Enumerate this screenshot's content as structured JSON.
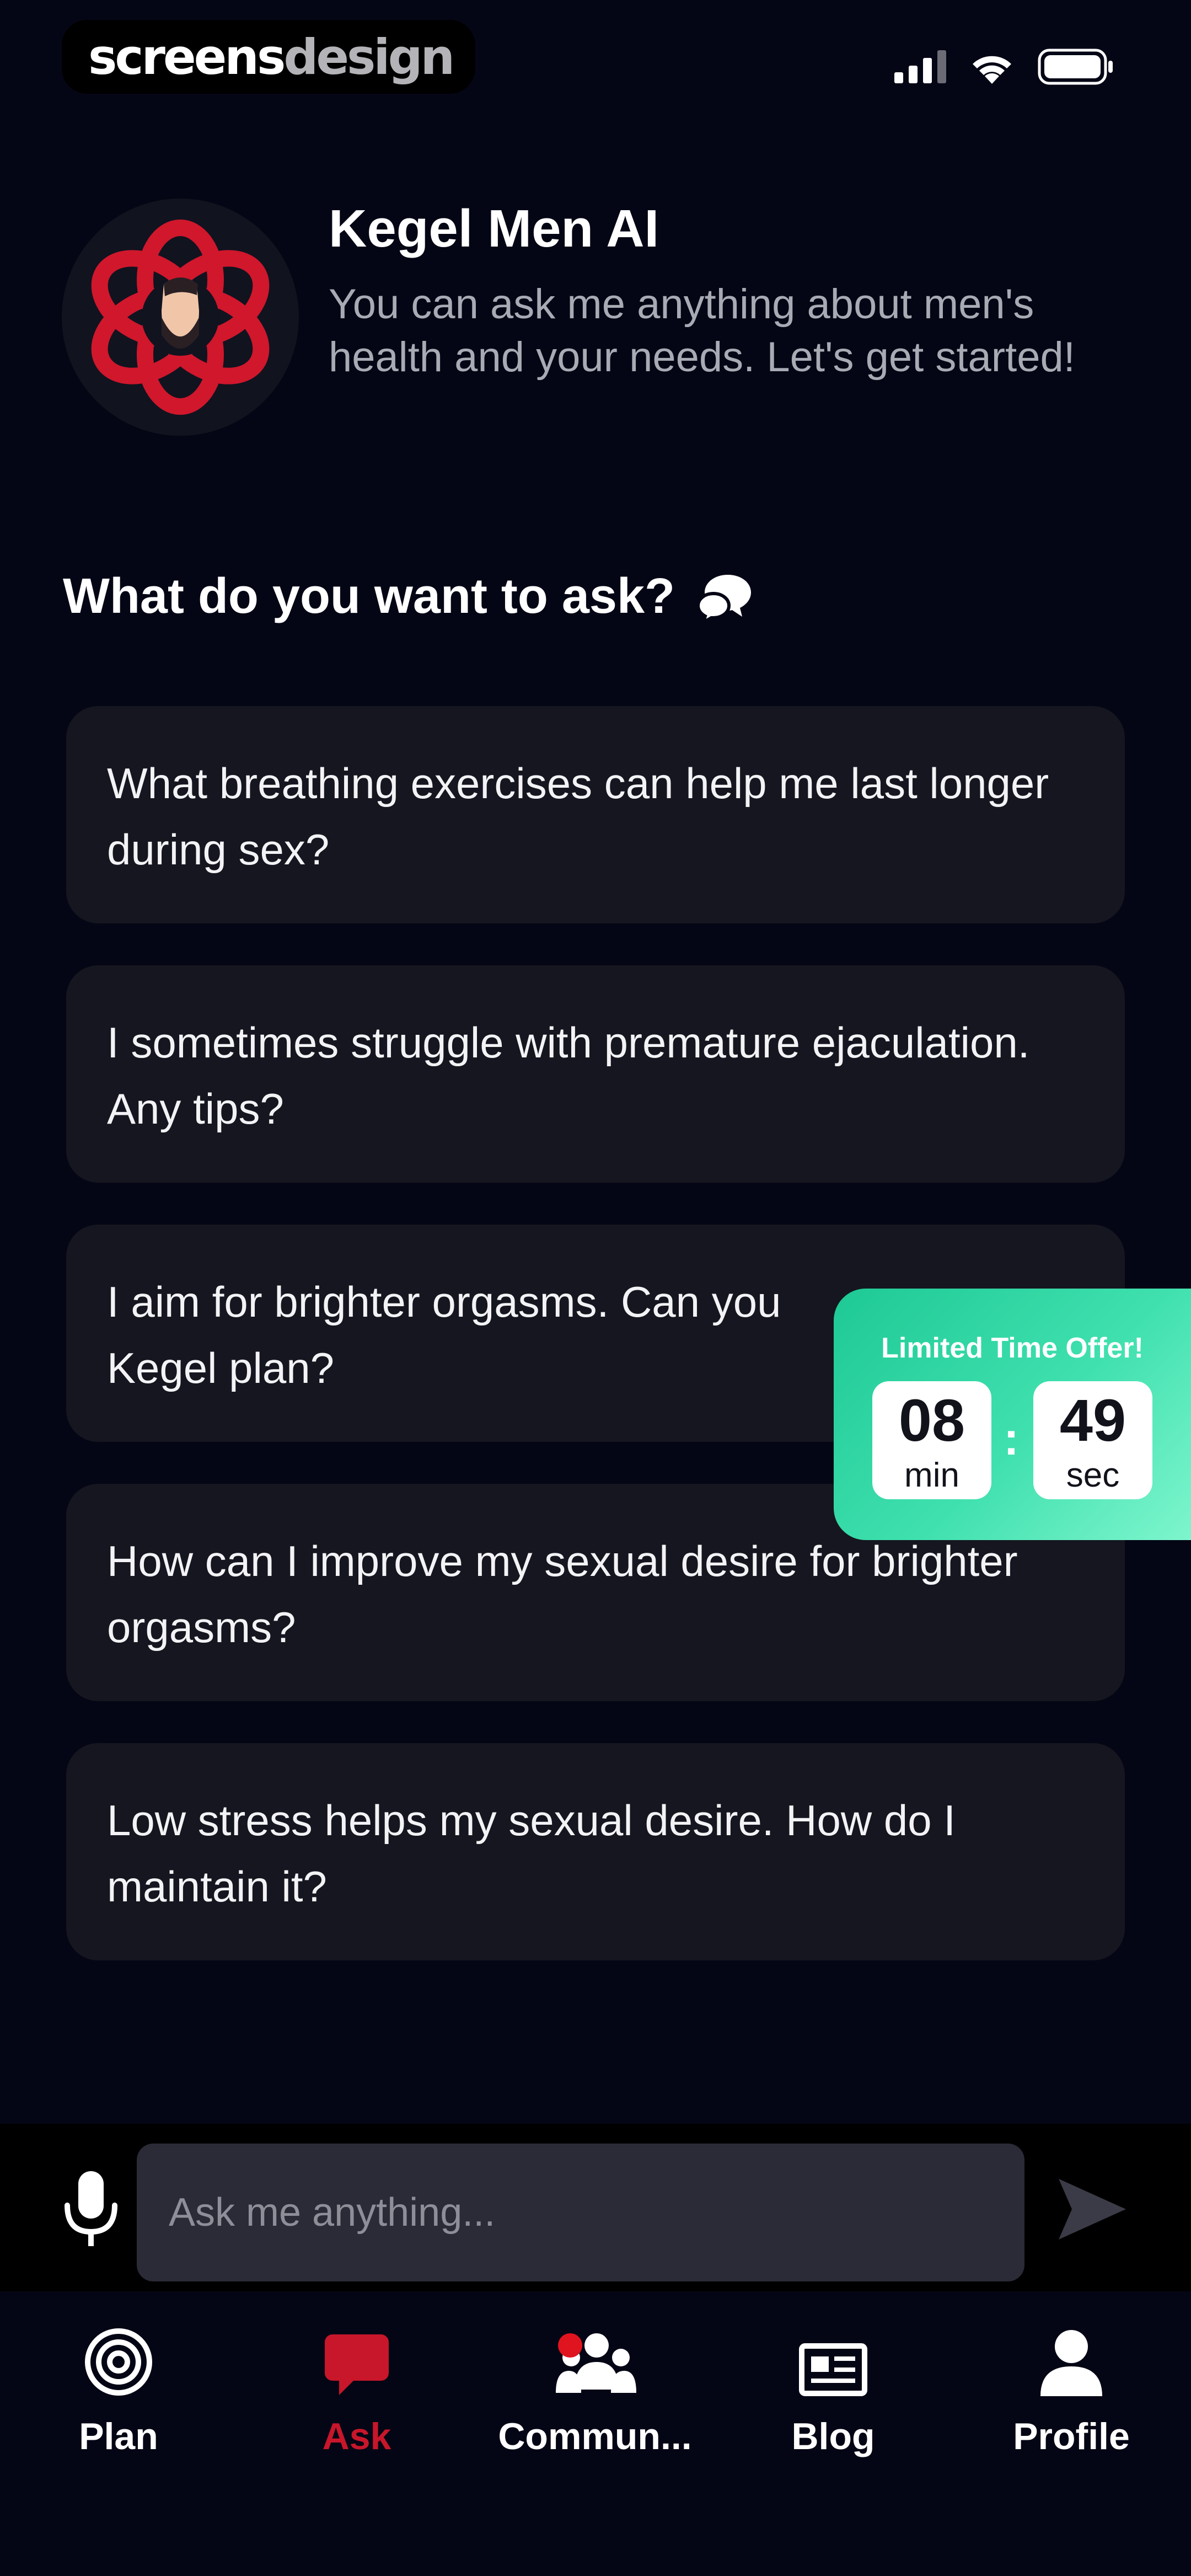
{
  "status_bar": {
    "brand_part1": "screens",
    "brand_part2": "design"
  },
  "header": {
    "bot_name": "Kegel Men AI",
    "bot_description": "You can ask me anything about men's health and your needs. Let's get started!"
  },
  "ask_section": {
    "heading": "What do you want to ask?",
    "suggestions": [
      "What breathing exercises can help me last longer during sex?",
      "I sometimes struggle with premature ejaculation. Any tips?",
      "I aim for brighter orgasms. Can you",
      "How can I improve my sexual desire for brighter orgasms?",
      "Low stress helps my sexual desire. How do I maintain it?"
    ],
    "suggestion_3_line2": "Kegel plan?"
  },
  "offer": {
    "title": "Limited Time Offer!",
    "minutes": "08",
    "minutes_unit": "min",
    "seconds": "49",
    "seconds_unit": "sec",
    "separator": ":"
  },
  "input": {
    "placeholder": "Ask me anything..."
  },
  "tabs": [
    {
      "label": "Plan",
      "icon": "target-icon",
      "active": false
    },
    {
      "label": "Ask",
      "icon": "chat-bubble-icon",
      "active": true
    },
    {
      "label": "Commun...",
      "icon": "community-icon",
      "active": false
    },
    {
      "label": "Blog",
      "icon": "newspaper-icon",
      "active": false
    },
    {
      "label": "Profile",
      "icon": "person-icon",
      "active": false
    }
  ],
  "colors": {
    "background": "#050615",
    "card": "#15161f",
    "accent_red": "#c8162a",
    "offer_green": "#2fd6a2",
    "input_bg": "#2a2b36"
  }
}
